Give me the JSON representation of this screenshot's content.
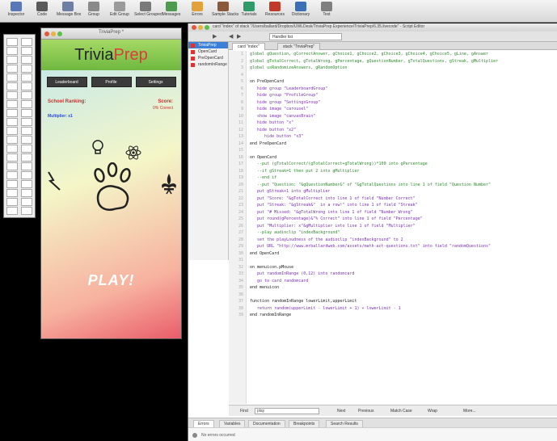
{
  "toolbar": {
    "items": [
      {
        "label": "Inspector",
        "icon": "inspector-icon",
        "color": "#5a78b8"
      },
      {
        "label": "Code",
        "icon": "code-icon",
        "color": "#5a5a5a"
      },
      {
        "label": "Message Box",
        "icon": "message-box-icon",
        "color": "#6d7fa5"
      },
      {
        "label": "Group",
        "icon": "group-icon",
        "color": "#8a8a8a"
      },
      {
        "label": "Edit Group",
        "icon": "edit-group-icon",
        "color": "#9a9a9a"
      },
      {
        "label": "Select Grouped",
        "icon": "select-grouped-icon",
        "color": "#7a7a7a"
      },
      {
        "label": "Messages",
        "icon": "messages-icon",
        "color": "#4d9b4d"
      },
      {
        "label": "Errors",
        "icon": "errors-icon",
        "color": "#e2a23a"
      },
      {
        "label": "Sample Stacks",
        "icon": "sample-stacks-icon",
        "color": "#8a5a3a"
      },
      {
        "label": "Tutorials",
        "icon": "tutorials-icon",
        "color": "#2f9b6a"
      },
      {
        "label": "Resources",
        "icon": "resources-icon",
        "color": "#c0392b"
      },
      {
        "label": "Dictionary",
        "icon": "dictionary-icon",
        "color": "#3b6fb6"
      },
      {
        "label": "Test",
        "icon": "test-icon",
        "color": "#7f7f7f"
      }
    ]
  },
  "card": {
    "title": "TriviaPrep *",
    "logo_main": "Trivia",
    "logo_accent": "Prep",
    "nav": [
      "Leaderboard",
      "Profile",
      "Settings"
    ],
    "ranking_label": "School Ranking:",
    "score_label": "Score:",
    "score_sub": "0% Correct",
    "multiplier_label": "Multiplier: x1",
    "play_label": "PLAY!"
  },
  "editor": {
    "title": "card \"index\" of stack \"/Users/ballard/Dropbox/UWLDesk/TriviaPrep Experience/TriviaPrep/6.35.livecode\" - Script Editor",
    "handler_select": "Handler list",
    "scripts": [
      {
        "label": "TriviaPrep",
        "selected": true
      },
      {
        "label": "OpenCard",
        "selected": false
      },
      {
        "label": "PreOpenCard",
        "selected": false
      },
      {
        "label": "randomInRange",
        "selected": false
      }
    ],
    "tabs": [
      "card \"index\"",
      "stack \"TriviaPrep\""
    ],
    "code_lines": [
      {
        "t": "global gQuestion, gCorrectAnswer, gChoice1, gChoice2, gChoice3, gChoice4, gChoice5, gLine, gAnswer",
        "c": "#2e8b2e"
      },
      {
        "t": "global gTotalCorrect, gTotalWrong, gPercentage, gQuestionNumber, gTotalQuestions, gStreak, gMultiplier",
        "c": "#2e8b2e"
      },
      {
        "t": "global usRandomizeAnswers, gRandomOption",
        "c": "#2e8b2e"
      },
      {
        "t": "",
        "c": "#222"
      },
      {
        "t": "on PreOpenCard",
        "c": "#222"
      },
      {
        "t": "   hide group \"LeaderboardGroup\"",
        "c": "#7a2fb6"
      },
      {
        "t": "   hide group \"ProfileGroup\"",
        "c": "#7a2fb6"
      },
      {
        "t": "   hide group \"SettingsGroup\"",
        "c": "#7a2fb6"
      },
      {
        "t": "   hide image \"carousel\"",
        "c": "#7a2fb6"
      },
      {
        "t": "   show image \"canvasBrain\"",
        "c": "#7a2fb6"
      },
      {
        "t": "   hide button \"x\"",
        "c": "#7a2fb6"
      },
      {
        "t": "   hide button \"x2\"",
        "c": "#7a2fb6"
      },
      {
        "t": "      hide button \"x3\"",
        "c": "#7a2fb6"
      },
      {
        "t": "end PreOpenCard",
        "c": "#222"
      },
      {
        "t": "",
        "c": "#222"
      },
      {
        "t": "on OpenCard",
        "c": "#222"
      },
      {
        "t": "   --put (gTotalCorrect/(gTotalCorrect+gTotalWrong))*100 into gPercentage",
        "c": "#2e8b2e"
      },
      {
        "t": "   --if gStreak=1 then put 2 into gMultiplier",
        "c": "#2e8b2e"
      },
      {
        "t": "   --end if",
        "c": "#2e8b2e"
      },
      {
        "t": "   --put \"Question: \"&gQuestionNumber&\" of \"&gTotalQuestions into line 1 of field \"Question Number\"",
        "c": "#2e8b2e"
      },
      {
        "t": "   put gStreak+1 into gMultiplier",
        "c": "#7a2fb6"
      },
      {
        "t": "   put \"Score: \"&gTotalCorrect into line 1 of field \"Number Correct\"",
        "c": "#7a2fb6"
      },
      {
        "t": "   put \"Streak: \"&gStreak&\"  in a row!\" into line 1 of field \"Streak\"",
        "c": "#7a2fb6"
      },
      {
        "t": "   put \"# Missed: \"&gTotalWrong into line 1 of field \"Number Wrong\"",
        "c": "#7a2fb6"
      },
      {
        "t": "   put round(gPercentage)&\"% Correct\" into line 1 of field \"Percentage\"",
        "c": "#7a2fb6"
      },
      {
        "t": "   put \"Multiplier: x\"&gMultiplier into line 1 of field \"Multiplier\"",
        "c": "#7a2fb6"
      },
      {
        "t": "   --play audioclip \"indexBackground\"",
        "c": "#2e8b2e"
      },
      {
        "t": "   set the playLoudness of the audioclip \"indexBackground\" to 2",
        "c": "#7a2fb6"
      },
      {
        "t": "   put URL \"http://www.mrballardweb.com/assets/math-act-questions.txt\" into field \"randomQuestions\"",
        "c": "#7a2fb6"
      },
      {
        "t": "end OpenCard",
        "c": "#222"
      },
      {
        "t": "",
        "c": "#222"
      },
      {
        "t": "on menuicon.pMouse",
        "c": "#222"
      },
      {
        "t": "   put randomInRange (0,12) into randomcard",
        "c": "#7a2fb6"
      },
      {
        "t": "   go to card randomcard",
        "c": "#7a2fb6"
      },
      {
        "t": "end menuicon",
        "c": "#222"
      },
      {
        "t": "",
        "c": "#222"
      },
      {
        "t": "function randomInRange lowerLimit,upperLimit",
        "c": "#222"
      },
      {
        "t": "   return random(upperLimit - lowerLimit + 1) + lowerLimit - 1",
        "c": "#7a2fb6"
      },
      {
        "t": "end randomInRange",
        "c": "#222"
      }
    ],
    "find": {
      "label": "Find",
      "value": "play",
      "options": [
        "Next",
        "Previous",
        "Match Case",
        "Wrap"
      ],
      "more": "More..."
    },
    "bottom_tabs": [
      "Errors",
      "Variables",
      "Documentation",
      "Breakpoints",
      "Search Results"
    ],
    "status": "No errors occurred"
  }
}
